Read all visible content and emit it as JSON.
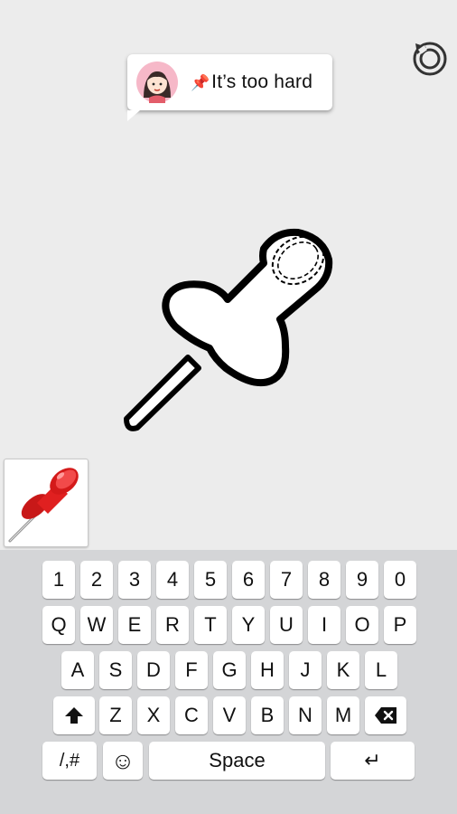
{
  "speech": {
    "pin_emoji": "📌",
    "text": "It’s too hard"
  },
  "icons": {
    "reset": "restart-icon",
    "avatar": "girl-avatar-icon",
    "puzzle": "pushpin-outline-drawing",
    "hint": "red-pushpin-icon"
  },
  "keyboard": {
    "row_numbers": [
      "1",
      "2",
      "3",
      "4",
      "5",
      "6",
      "7",
      "8",
      "9",
      "0"
    ],
    "row_top": [
      "Q",
      "W",
      "E",
      "R",
      "T",
      "Y",
      "U",
      "I",
      "O",
      "P"
    ],
    "row_middle": [
      "A",
      "S",
      "D",
      "F",
      "G",
      "H",
      "J",
      "K",
      "L"
    ],
    "row_bottom": [
      "Z",
      "X",
      "C",
      "V",
      "B",
      "N",
      "M"
    ],
    "symbols_label": "/,#",
    "emoji_label": "☺",
    "space_label": "Space",
    "enter_label": "↵"
  },
  "colors": {
    "background": "#ececec",
    "keyboard_bg": "#d4d5d7",
    "pin_red": "#e02020"
  }
}
